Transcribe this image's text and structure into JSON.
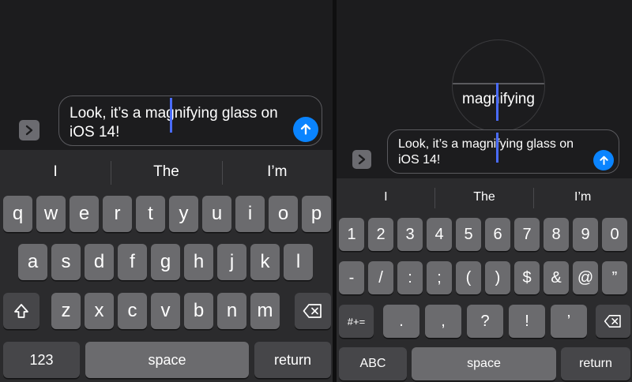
{
  "message": {
    "text_line1": "Look, it’s a magnifying glass on",
    "text_line2": "iOS 14!"
  },
  "magnifier": {
    "text": "magnifying"
  },
  "suggestions": [
    "I",
    "The",
    "I’m"
  ],
  "left_keyboard": {
    "row1": [
      "q",
      "w",
      "e",
      "r",
      "t",
      "y",
      "u",
      "i",
      "o",
      "p"
    ],
    "row2": [
      "a",
      "s",
      "d",
      "f",
      "g",
      "h",
      "j",
      "k",
      "l"
    ],
    "row3": [
      "z",
      "x",
      "c",
      "v",
      "b",
      "n",
      "m"
    ],
    "numbers_label": "123",
    "space_label": "space",
    "return_label": "return",
    "shift_icon": "shift-icon",
    "delete_icon": "delete-icon"
  },
  "right_keyboard": {
    "row1": [
      "1",
      "2",
      "3",
      "4",
      "5",
      "6",
      "7",
      "8",
      "9",
      "0"
    ],
    "row2": [
      "-",
      "/",
      ":",
      ";",
      "(",
      ")",
      "$",
      "&",
      "@",
      "”"
    ],
    "row3": [
      ".",
      ",",
      "?",
      "!",
      "’"
    ],
    "symbols_label": "#+=",
    "abc_label": "ABC",
    "space_label": "space",
    "return_label": "return",
    "delete_icon": "delete-icon"
  },
  "icons": {
    "expand": "chevron-right-icon",
    "send": "arrow-up-icon"
  },
  "colors": {
    "background": "#1c1c1e",
    "keyboard": "#2b2b2d",
    "key": "#6b6b6e",
    "special_key": "#464649",
    "send_button": "#0a84ff",
    "caret": "#4a6cff"
  }
}
